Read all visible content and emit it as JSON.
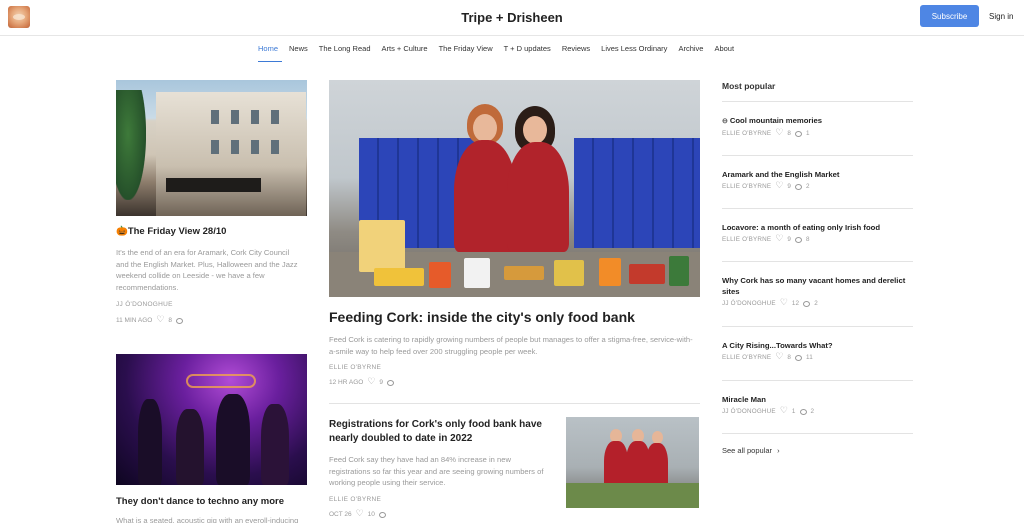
{
  "header": {
    "site_title": "Tripe + Drisheen",
    "subscribe_label": "Subscribe",
    "signin_label": "Sign in"
  },
  "nav": {
    "items": [
      "Home",
      "News",
      "The Long Read",
      "Arts + Culture",
      "The Friday View",
      "T + D updates",
      "Reviews",
      "Lives Less Ordinary",
      "Archive",
      "About"
    ]
  },
  "left_posts": [
    {
      "title": "🎃The Friday View 28/10",
      "excerpt": "It's the end of an era for Aramark, Cork City Council and the English Market. Plus, Halloween and the Jazz weekend collide on Leeside - we have a few recommendations.",
      "author": "JJ Ó'DONOGHUE",
      "date": "11 MIN AGO",
      "likes": "8"
    },
    {
      "title": "They don't dance to techno any more",
      "excerpt": "What is a seated, acoustic gig with an eyeroll-inducing",
      "author": "",
      "date": "",
      "likes": ""
    }
  ],
  "featured": {
    "title": "Feeding Cork: inside the city's only food bank",
    "excerpt": "Feed Cork is catering to rapidly growing numbers of people but manages to offer a stigma-free, service-with-a-smile way to help feed over 200 struggling people per week.",
    "author": "ELLIE O'BYRNE",
    "date": "12 HR AGO",
    "likes": "9"
  },
  "secondary": {
    "title": "Registrations for Cork's only food bank have nearly doubled to date in 2022",
    "excerpt": "Feed Cork say they have had an 84% increase in new registrations so far this year and are seeing growing numbers of working people using their service.",
    "author": "ELLIE O'BYRNE",
    "date": "OCT 26",
    "likes": "10"
  },
  "popular": {
    "heading": "Most popular",
    "items": [
      {
        "title": "Cool mountain memories",
        "author": "ELLIE O'BYRNE",
        "likes": "8",
        "comments": "1"
      },
      {
        "title": "Aramark and the English Market",
        "author": "ELLIE O'BYRNE",
        "likes": "9",
        "comments": "2"
      },
      {
        "title": "Locavore: a month of eating only Irish food",
        "author": "ELLIE O'BYRNE",
        "likes": "9",
        "comments": "8"
      },
      {
        "title": "Why Cork has so many vacant homes and derelict sites",
        "author": "JJ Ó'DONOGHUE",
        "likes": "12",
        "comments": "2"
      },
      {
        "title": "A City Rising...Towards What?",
        "author": "ELLIE O'BYRNE",
        "likes": "8",
        "comments": "11"
      },
      {
        "title": "Miracle Man",
        "author": "JJ Ó'DONOGHUE",
        "likes": "1",
        "comments": "2"
      }
    ],
    "see_all": "See all popular"
  },
  "colors": {
    "accent": "#4e86e4",
    "nav_active": "#3d7ad6",
    "muted_text": "#9a9a9a"
  }
}
